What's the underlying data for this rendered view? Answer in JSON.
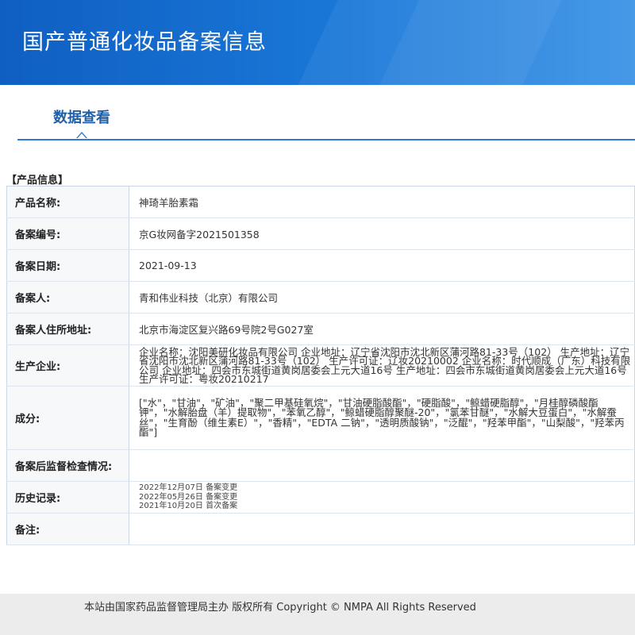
{
  "header": {
    "title": "国产普通化妆品备案信息"
  },
  "tabs": {
    "active_label": "数据查看"
  },
  "section": {
    "heading": "【产品信息】"
  },
  "fields": {
    "product_name": {
      "label": "产品名称:",
      "value": "神琦羊胎素霜"
    },
    "record_number": {
      "label": "备案编号:",
      "value": "京G妆网备字2021501358"
    },
    "record_date": {
      "label": "备案日期:",
      "value": "2021-09-13"
    },
    "registrant": {
      "label": "备案人:",
      "value": "青和伟业科技（北京）有限公司"
    },
    "registrant_address": {
      "label": "备案人住所地址:",
      "value": "北京市海淀区复兴路69号院2号G027室"
    },
    "manufacturer": {
      "label": "生产企业:",
      "value": "企业名称：沈阳美研化妆品有限公司 企业地址：辽宁省沈阳市沈北新区蒲河路81-33号（102） 生产地址：辽宁省沈阳市沈北新区蒲河路81-33号（102） 生产许可证：辽妆20210002 企业名称：时代顺成（广东）科技有限公司 企业地址：四会市东城街道黄岗居委会上元大道16号 生产地址：四会市东城街道黄岗居委会上元大道16号 生产许可证：粤妆20210217"
    },
    "ingredients": {
      "label": "成分:",
      "value": "[\"水\"，\"甘油\"，\"矿油\"，\"聚二甲基硅氧烷\"，\"甘油硬脂酸酯\"，\"硬脂酸\"，\"鲸蜡硬脂醇\"，\"月桂醇磷酸酯钾\"，\"水解胎盘（羊）提取物\"，\"苯氧乙醇\"，\"鲸蜡硬脂醇聚醚-20\"，\"氯苯甘醚\"，\"水解大豆蛋白\"，\"水解蚕丝\"，\"生育酚（维生素E）\"，\"香精\"，\"EDTA 二钠\"，\"透明质酸钠\"，\"泛醌\"，\"羟苯甲酯\"，\"山梨酸\"，\"羟苯丙酯\"]"
    },
    "post_inspection": {
      "label": "备案后监督检查情况:",
      "value": ""
    },
    "history": {
      "label": "历史记录:",
      "entries": [
        "2022年12月07日 备案变更",
        "2022年05月26日 备案变更",
        "2021年10月20日 首次备案"
      ]
    },
    "remarks": {
      "label": "备注:",
      "value": ""
    }
  },
  "footer": {
    "text": "本站由国家药品监督管理局主办 版权所有 Copyright © NMPA All Rights Reserved"
  }
}
